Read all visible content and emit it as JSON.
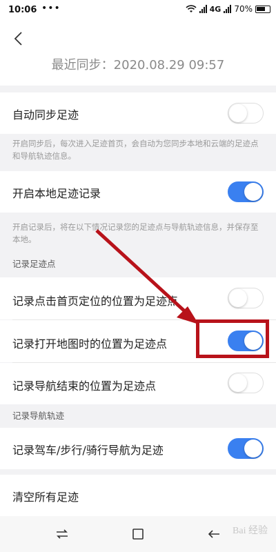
{
  "status_bar": {
    "time": "10:06",
    "dots": "•••",
    "network": "4G",
    "battery": "70%"
  },
  "header": {
    "last_sync": "最近同步：2020.08.29  09:57"
  },
  "settings": {
    "auto_sync": {
      "label": "自动同步足迹",
      "enabled": false
    },
    "auto_sync_note": "开启同步后，每次进入足迹首页，会自动为您同步本地和云端的足迹点和导航轨迹信息。",
    "local_record": {
      "label": "开启本地足迹记录",
      "enabled": true
    },
    "local_record_note": "开启记录后，将在以下情况记录您的足迹点与导航轨迹信息，并保存至本地。",
    "section_points": "记录足迹点",
    "points": [
      {
        "label": "记录点击首页定位的位置为足迹点",
        "enabled": false
      },
      {
        "label": "记录打开地图时的位置为足迹点",
        "enabled": true
      },
      {
        "label": "记录导航结束的位置为足迹点",
        "enabled": false
      }
    ],
    "section_nav": "记录导航轨迹",
    "nav_track": {
      "label": "记录驾车/步行/骑行导航为足迹",
      "enabled": true
    },
    "clear_all": "清空所有足迹"
  },
  "colors": {
    "toggle_on": "#3a80f0",
    "annotation": "#b8121a"
  },
  "watermark": "Bai 经验"
}
